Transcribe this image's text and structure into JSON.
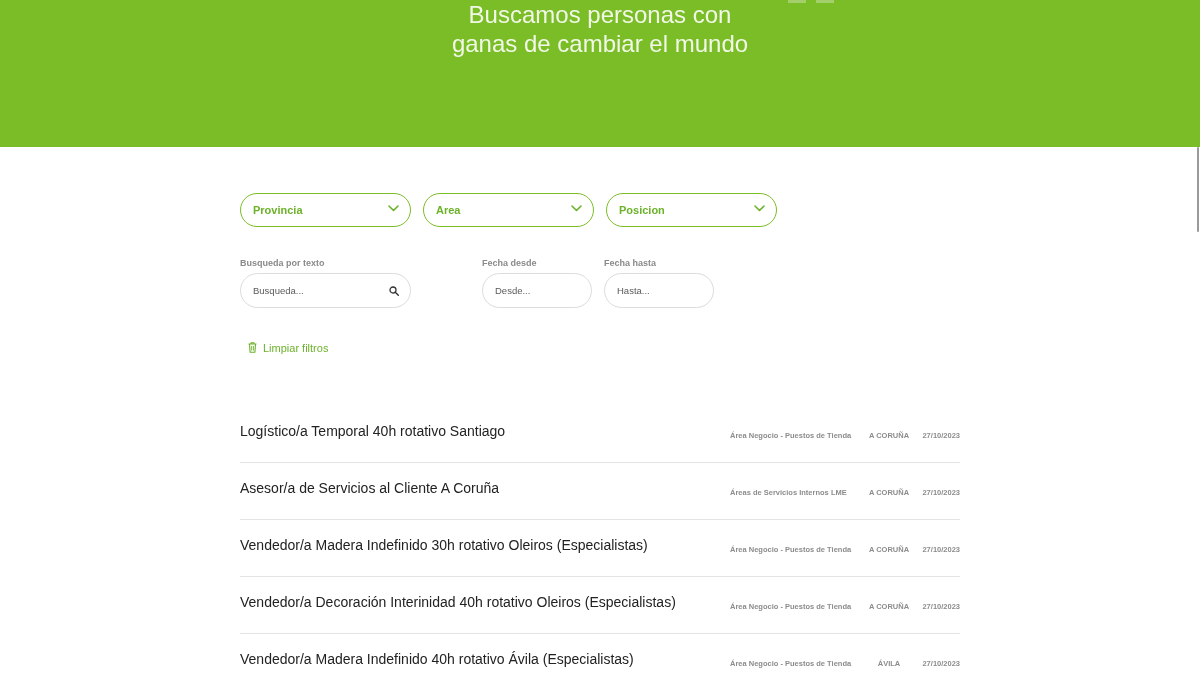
{
  "hero": {
    "title": "Buscamos personas con ganas de cambiar el mundo"
  },
  "filters": {
    "dropdowns": [
      {
        "label": "Provincia"
      },
      {
        "label": "Area"
      },
      {
        "label": "Posicion"
      }
    ],
    "fields": [
      {
        "kind": "search",
        "label": "Busqueda por texto",
        "placeholder": "Busqueda..."
      },
      {
        "kind": "date",
        "label": "Fecha desde",
        "placeholder": "Desde..."
      },
      {
        "kind": "date",
        "label": "Fecha hasta",
        "placeholder": "Hasta..."
      }
    ],
    "clear_button": "Limpiar filtros"
  },
  "jobs": [
    {
      "title": "Logístico/a Temporal 40h rotativo Santiago",
      "area": "Área Negocio - Puestos de Tienda",
      "province": "A CORUÑA",
      "date": "27/10/2023"
    },
    {
      "title": "Asesor/a de Servicios al Cliente A Coruña",
      "area": "Áreas de Servicios Internos LME",
      "province": "A CORUÑA",
      "date": "27/10/2023"
    },
    {
      "title": "Vendedor/a Madera Indefinido 30h rotativo Oleiros (Especialistas)",
      "area": "Área Negocio - Puestos de Tienda",
      "province": "A CORUÑA",
      "date": "27/10/2023"
    },
    {
      "title": "Vendedor/a Decoración Interinidad 40h rotativo Oleiros (Especialistas)",
      "area": "Área Negocio - Puestos de Tienda",
      "province": "A CORUÑA",
      "date": "27/10/2023"
    },
    {
      "title": "Vendedor/a Madera Indefinido 40h rotativo Ávila (Especialistas)",
      "area": "Área Negocio - Puestos de Tienda",
      "province": "ÁVILA",
      "date": "27/10/2023"
    }
  ]
}
